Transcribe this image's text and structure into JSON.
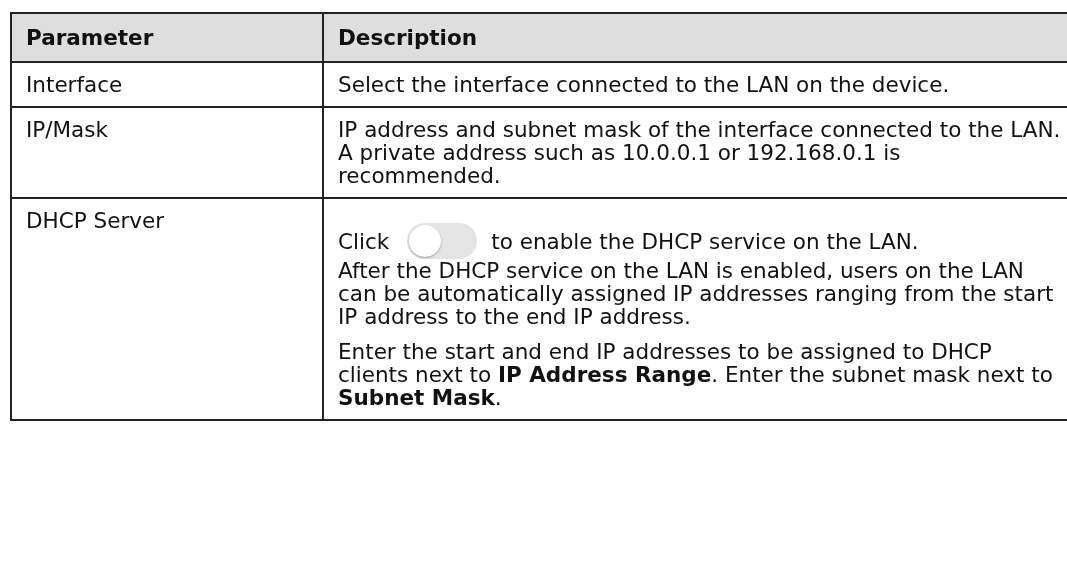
{
  "table": {
    "columns": [
      "Parameter",
      "Description"
    ],
    "rows": [
      {
        "parameter": "Interface",
        "paragraphs": [
          {
            "kind": "text",
            "text": "Select the interface connected to the LAN on the device."
          }
        ]
      },
      {
        "parameter": "IP/Mask",
        "paragraphs": [
          {
            "kind": "text",
            "text": "IP address and subnet mask of the interface connected to the LAN. A private address such as 10.0.0.1 or 192.168.0.1 is recommended."
          }
        ]
      },
      {
        "parameter": "DHCP Server",
        "paragraphs": [
          {
            "kind": "toggle",
            "before": "Click",
            "on": false,
            "after": "to enable the DHCP service on the LAN.",
            "continuation": "After the DHCP service on the LAN is enabled, users on the LAN can be automatically assigned IP addresses ranging from the start IP address to the end IP address."
          },
          {
            "kind": "text",
            "text": "Enter the start and end IP addresses to be assigned to DHCP clients next to **IP Address Range**. Enter the subnet mask next to **Subnet Mask**."
          }
        ]
      }
    ]
  }
}
